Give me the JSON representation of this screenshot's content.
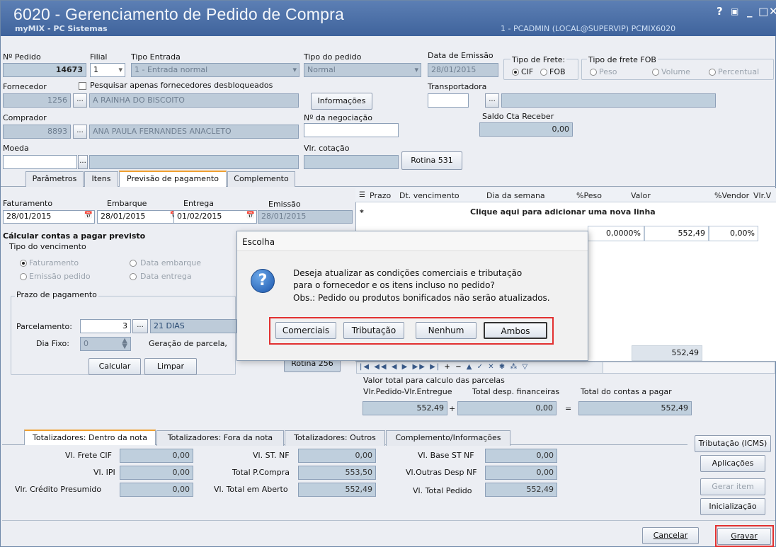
{
  "window": {
    "title": "6020 - Gerenciamento de Pedido de Compra",
    "subtitle": "myMIX - PC Sistemas",
    "session": "1 - PCADMIN (LOCAL@SUPERVIP)  PCMIX6020",
    "controls": [
      "?",
      "▣",
      "_",
      "□",
      "✕"
    ]
  },
  "header": {
    "pedido_label": "Nº Pedido",
    "pedido_value": "14673",
    "filial_label": "Filial",
    "filial_value": "1",
    "tipo_entrada_label": "Tipo Entrada",
    "tipo_entrada_value": "1 - Entrada normal",
    "tipo_pedido_label": "Tipo do pedido",
    "tipo_pedido_value": "Normal",
    "data_emissao_label": "Data de Emissão",
    "data_emissao_value": "28/01/2015",
    "tipo_frete_label": "Tipo de Frete:",
    "frete_cif": "CIF",
    "frete_fob": "FOB",
    "tipo_frete_fob_label": "Tipo de frete FOB",
    "fob_peso": "Peso",
    "fob_volume": "Volume",
    "fob_percentual": "Percentual",
    "fornecedor_label": "Fornecedor",
    "pesquisar_label": "Pesquisar apenas fornecedores desbloqueados",
    "fornecedor_code": "1256",
    "fornecedor_name": "A RAINHA DO BISCOITO",
    "informacoes_button": "Informações",
    "transportadora_label": "Transportadora",
    "comprador_label": "Comprador",
    "comprador_code": "8893",
    "comprador_name": "ANA PAULA FERNANDES ANACLETO",
    "negociacao_label": "Nº da negociação",
    "saldo_label": "Saldo Cta Receber",
    "saldo_value": "0,00",
    "moeda_label": "Moeda",
    "vlr_cotacao_label": "Vlr. cotação",
    "rotina531_button": "Rotina 531"
  },
  "tabs": [
    "Parâmetros",
    "Itens",
    "Previsão de pagamento",
    "Complemento"
  ],
  "previsao": {
    "faturamento_label": "Faturamento",
    "faturamento_value": "28/01/2015",
    "embarque_label": "Embarque",
    "embarque_value": "28/01/2015",
    "entrega_label": "Entrega",
    "entrega_value": "01/02/2015",
    "emissao_label": "Emissão",
    "emissao_value": "28/01/2015",
    "calcular_title": "Cálcular contas a pagar previsto",
    "tipo_venc_label": "Tipo do vencimento",
    "opt_faturamento": "Faturamento",
    "opt_data_embarque": "Data embarque",
    "opt_emissao_pedido": "Emissão pedido",
    "opt_data_entrega": "Data entrega",
    "prazo_label": "Prazo de pagamento",
    "parcelamento_label": "Parcelamento:",
    "parcelamento_value": "3",
    "parcelamento_desc": "21 DIAS",
    "dia_fixo_label": "Dia Fixo:",
    "dia_fixo_value": "0",
    "geracao_label": "Geração de parcela,",
    "calcular_button": "Calcular",
    "limpar_button": "Limpar",
    "rotina256_button": "Rotina 256"
  },
  "grid": {
    "columns": [
      "Prazo",
      "Dt. vencimento",
      "Dia da semana",
      "%Peso",
      "Valor",
      "%Vendor",
      "Vlr.V"
    ],
    "add_row": "Clique aqui para adicionar uma nova linha",
    "row": {
      "peso": "0,0000%",
      "valor": "552,49",
      "vendor": "0,00%"
    },
    "total": "552,49"
  },
  "valores": {
    "valor_total_label": "Valor total para calculo das parcelas",
    "pedido_entregue_label": "Vlr.Pedido-Vlr.Entregue",
    "pedido_entregue_value": "552,49",
    "plus": "+",
    "desp_label": "Total desp. financeiras",
    "desp_value": "0,00",
    "equals": "=",
    "contas_label": "Total do contas a pagar",
    "contas_value": "552,49"
  },
  "bottom_tabs": [
    "Totalizadores: Dentro da nota",
    "Totalizadores: Fora da nota",
    "Totalizadores: Outros",
    "Complemento/Informações"
  ],
  "totals": [
    {
      "label": "Vl. Frete CIF",
      "value": "0,00"
    },
    {
      "label": "Vl. IPI",
      "value": "0,00"
    },
    {
      "label": "Vlr. Crédito Presumido",
      "value": "0,00"
    },
    {
      "label": "Vl. ST. NF",
      "value": "0,00"
    },
    {
      "label": "Total P.Compra",
      "value": "553,50"
    },
    {
      "label": "Vl. Total em Aberto",
      "value": "552,49"
    },
    {
      "label": "Vl. Base ST NF",
      "value": "0,00"
    },
    {
      "label": "Vl.Outras Desp NF",
      "value": "0,00"
    },
    {
      "label": "Vl. Total  Pedido",
      "value": "552,49"
    }
  ],
  "side_buttons": [
    "Tributação (ICMS)",
    "Aplicações",
    "Gerar item",
    "Inicialização"
  ],
  "footer": {
    "cancelar": "Cancelar",
    "gravar": "Gravar"
  },
  "dialog": {
    "title": "Escolha",
    "message": [
      "Deseja atualizar as condições comerciais e tributação",
      "para o fornecedor e os itens incluso no pedido?",
      "Obs.: Pedido ou produtos bonificados não serão atualizados."
    ],
    "buttons": [
      "Comerciais",
      "Tributação",
      "Nenhum",
      "Ambos"
    ]
  }
}
